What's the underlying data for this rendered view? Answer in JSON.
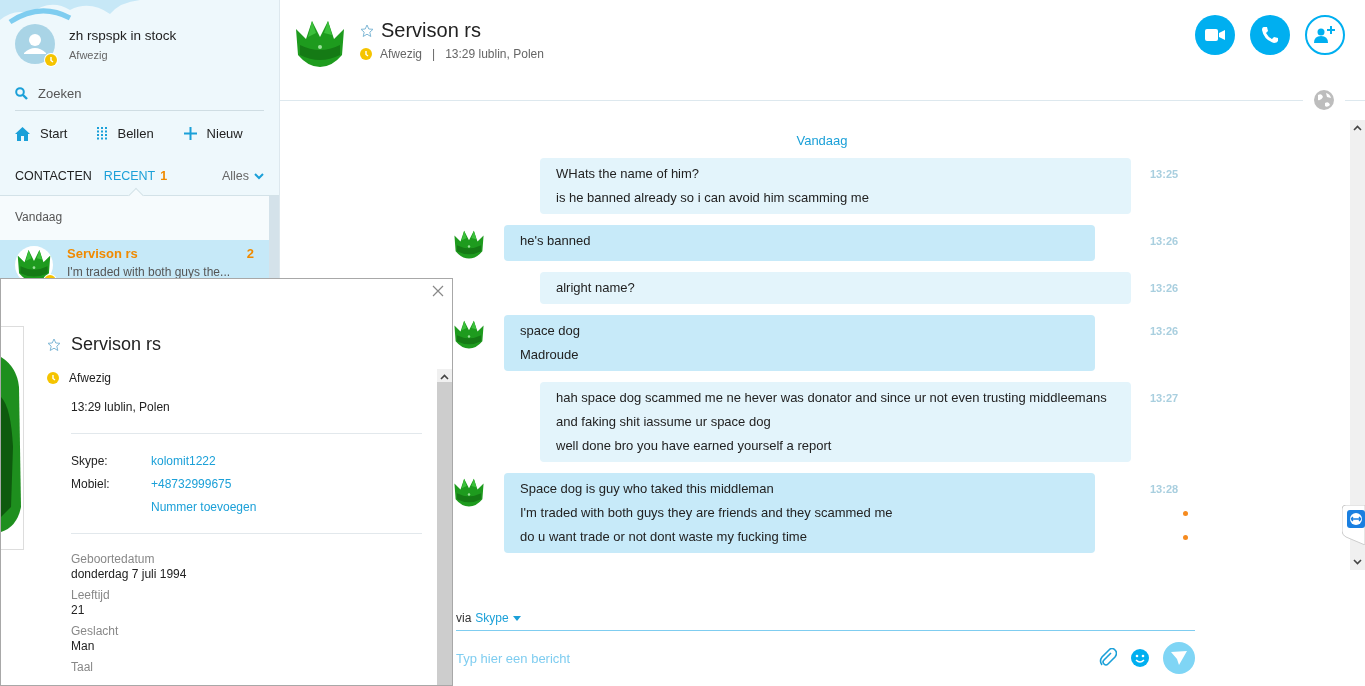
{
  "sidebar": {
    "user": {
      "name": "zh rspspk in stock",
      "status": "Afwezig"
    },
    "search": {
      "placeholder": "Zoeken"
    },
    "nav": [
      {
        "kind": "home",
        "label": "Start"
      },
      {
        "kind": "dialpad",
        "label": "Bellen"
      },
      {
        "kind": "plus",
        "label": "Nieuw"
      }
    ],
    "tabs": [
      {
        "label": "CONTACTEN",
        "selected": false
      },
      {
        "label": "RECENT",
        "selected": true,
        "badge": "1"
      }
    ],
    "filter": "Alles",
    "section": "Vandaag",
    "conversations": [
      {
        "name": "Servison rs",
        "preview": "I'm traded with both guys the...",
        "count": "2",
        "selected": true
      }
    ]
  },
  "header": {
    "name": "Servison rs",
    "status": "Afwezig",
    "separator": "|",
    "local_time": "13:29 lublin, Polen"
  },
  "chat": {
    "day": "Vandaag",
    "messages": [
      {
        "kind": "outgoing",
        "time": "13:25",
        "lines": [
          {
            "text": "WHats the name of him?",
            "unread": false
          },
          {
            "text": "is he banned already so i can avoid him scamming me",
            "unread": false
          }
        ]
      },
      {
        "kind": "incoming",
        "time": "13:26",
        "lines": [
          {
            "text": "he's banned",
            "unread": false
          }
        ]
      },
      {
        "kind": "outgoing",
        "time": "13:26",
        "lines": [
          {
            "text": "alright name?",
            "unread": false
          }
        ]
      },
      {
        "kind": "incoming",
        "time": "13:26",
        "lines": [
          {
            "text": "space dog",
            "unread": false
          },
          {
            "text": "Madroude",
            "unread": false
          }
        ]
      },
      {
        "kind": "outgoing",
        "time": "13:27",
        "lines": [
          {
            "text": "hah space dog scammed me ne hever was donator and since ur not even trusting middleemans and faking shit iassume ur space dog",
            "unread": false
          },
          {
            "text": "well done bro you have earned yourself a report",
            "unread": false
          }
        ]
      },
      {
        "kind": "incoming",
        "time": "13:28",
        "lines": [
          {
            "text": "Space dog is guy who taked this middleman",
            "unread": false
          },
          {
            "text": "I'm traded with both guys they are friends and they scammed me",
            "unread": true
          },
          {
            "text": "do u want trade or not dont waste my fucking time",
            "unread": true
          }
        ]
      }
    ]
  },
  "composer": {
    "via": "via",
    "service": "Skype",
    "placeholder": "Typ hier een bericht"
  },
  "profile": {
    "name": "Servison rs",
    "status": "Afwezig",
    "local_time": "13:29 lublin, Polen",
    "contacts": [
      {
        "label": "Skype:",
        "value": "kolomit1222"
      },
      {
        "label": "Mobiel:",
        "value": "+48732999675"
      }
    ],
    "add_number": "Nummer toevoegen",
    "details": [
      {
        "label": "Geboortedatum",
        "value": "donderdag 7 juli 1994"
      },
      {
        "label": "Leeftijd",
        "value": "21"
      },
      {
        "label": "Geslacht",
        "value": "Man"
      },
      {
        "label": "Taal"
      }
    ]
  }
}
